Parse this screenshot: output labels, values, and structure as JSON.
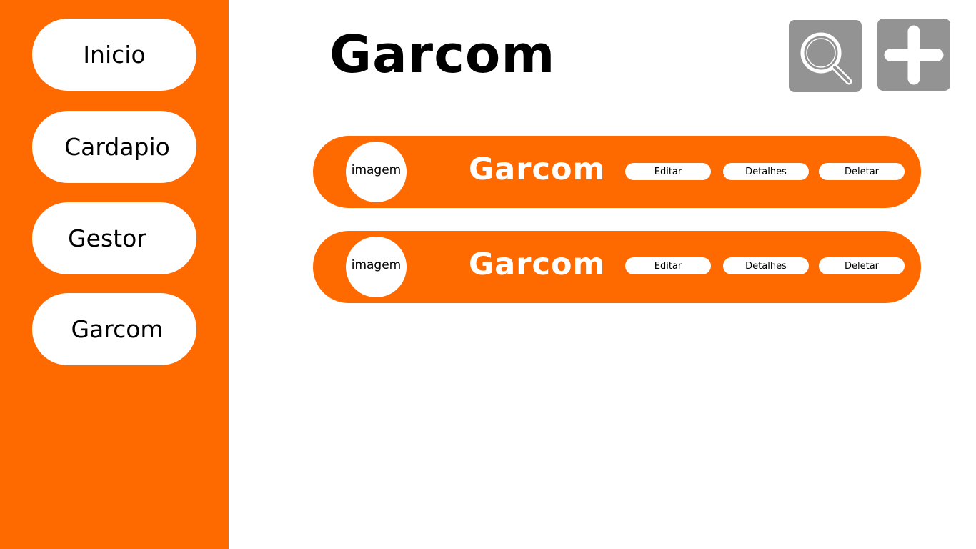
{
  "sidebar": {
    "items": [
      {
        "label": "Inicio"
      },
      {
        "label": "Cardapio"
      },
      {
        "label": "Gestor"
      },
      {
        "label": "Garcom"
      }
    ]
  },
  "header": {
    "title": "Garcom",
    "search_icon": "search-icon",
    "add_icon": "plus-icon"
  },
  "cards": [
    {
      "image_label": "imagem",
      "name": "Garcom",
      "actions": {
        "edit": "Editar",
        "details": "Detalhes",
        "delete": "Deletar"
      }
    },
    {
      "image_label": "imagem",
      "name": "Garcom",
      "actions": {
        "edit": "Editar",
        "details": "Detalhes",
        "delete": "Deletar"
      }
    }
  ],
  "colors": {
    "accent": "#ff6a00",
    "icon_button": "#939393",
    "background": "#ffffff"
  }
}
